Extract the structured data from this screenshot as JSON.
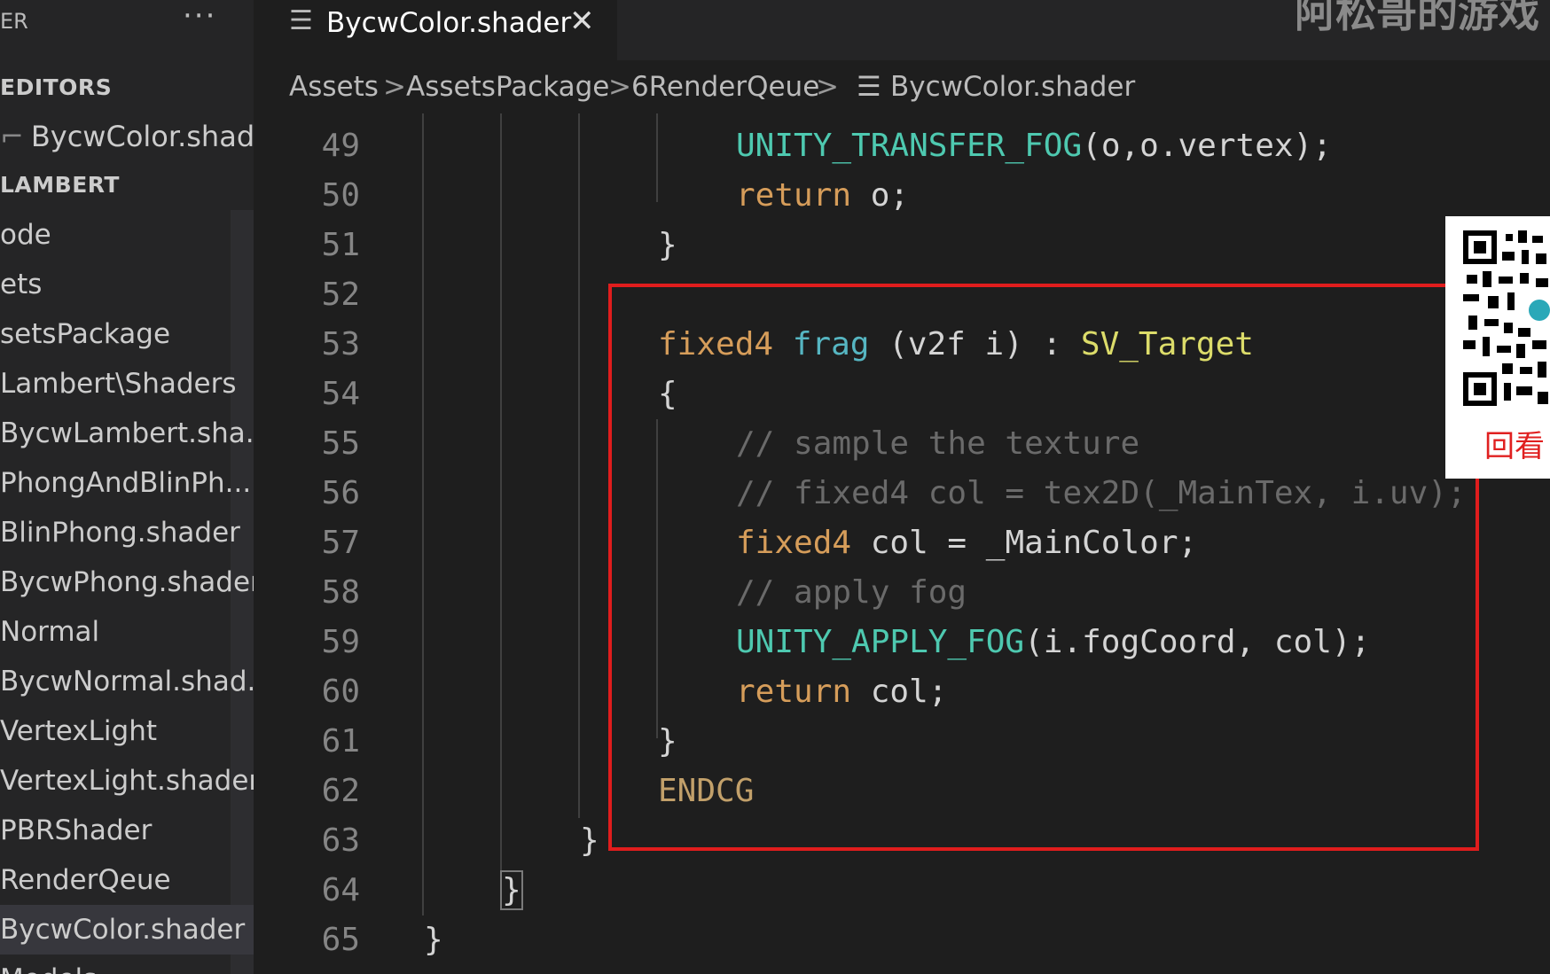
{
  "sidebar": {
    "header_title": "ER",
    "more_label": "···",
    "open_editors_title": "EDITORS",
    "open_editors_item": "BycwColor.shad...",
    "project_title": "LAMBERT",
    "tree": [
      "ode",
      "ets",
      "setsPackage",
      "Lambert\\Shaders",
      "BycwLambert.sha...",
      "PhongAndBlinPh...",
      "BlinPhong.shader",
      "BycwPhong.shader",
      "Normal",
      "BycwNormal.shad...",
      "VertexLight",
      "VertexLight.shader",
      "PBRShader",
      "RenderQeue",
      "BycwColor.shader",
      "Models"
    ]
  },
  "tab": {
    "icon": "lines-icon",
    "label": "BycwColor.shader",
    "close": "✕"
  },
  "watermark": "阿松哥的游戏",
  "breadcrumb": {
    "items": [
      "Assets",
      "AssetsPackage",
      "6RenderQeue",
      "BycwColor.shader"
    ],
    "separator": ">",
    "file_icon": "lines-icon"
  },
  "editor": {
    "line_numbers": [
      "49",
      "50",
      "51",
      "52",
      "53",
      "54",
      "55",
      "56",
      "57",
      "58",
      "59",
      "60",
      "61",
      "62",
      "63",
      "64",
      "65"
    ],
    "lines": {
      "l49": {
        "macro": "UNITY_TRANSFER_FOG",
        "rest": "(o,o.vertex);"
      },
      "l50": {
        "kw": "return",
        "rest": " o;"
      },
      "l51": "}",
      "l53": {
        "type": "fixed4",
        "fn": "frag",
        "params": "(v2f i) :",
        "semantic": "SV_Target"
      },
      "l54": "{",
      "l55": "// sample the texture",
      "l56": "// fixed4 col = tex2D(_MainTex, i.uv);",
      "l57": {
        "type": "fixed4",
        "rest": " col = _MainColor;"
      },
      "l58": "// apply fog",
      "l59": {
        "macro": "UNITY_APPLY_FOG",
        "rest": "(i.fogCoord, col);"
      },
      "l60": {
        "kw": "return",
        "rest": " col;"
      },
      "l61": "}",
      "l62": "ENDCG",
      "l63": "}",
      "l64": "}",
      "l65": "}"
    }
  },
  "qr": {
    "caption": "回看"
  },
  "colors": {
    "highlight_box": "#e01d1d",
    "editor_bg": "#1e1e1e",
    "sidebar_bg": "#252526"
  }
}
